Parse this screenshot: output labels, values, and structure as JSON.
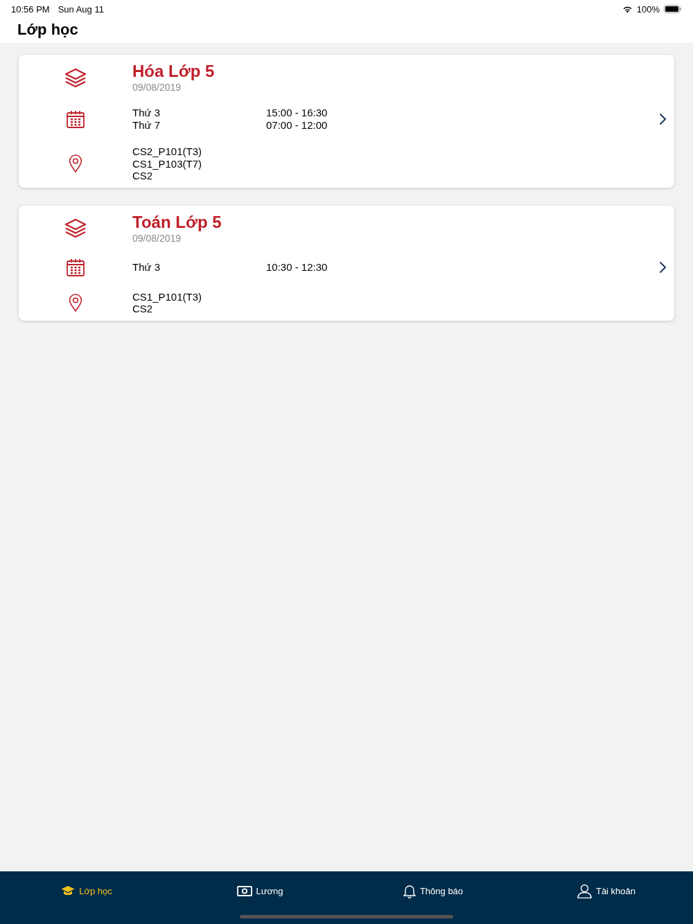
{
  "status_bar": {
    "time": "10:56 PM",
    "date": "Sun Aug 11",
    "battery": "100%"
  },
  "header": {
    "title": "Lớp học"
  },
  "classes": [
    {
      "name": "Hóa Lớp 5",
      "date": "09/08/2019",
      "schedule": [
        {
          "day": "Thứ 3",
          "time": "15:00 - 16:30"
        },
        {
          "day": "Thứ 7",
          "time": "07:00 - 12:00"
        }
      ],
      "locations": [
        "CS2_P101(T3)",
        "CS1_P103(T7)",
        "CS2"
      ]
    },
    {
      "name": "Toán Lớp 5",
      "date": "09/08/2019",
      "schedule": [
        {
          "day": "Thứ 3",
          "time": "10:30 - 12:30"
        }
      ],
      "locations": [
        "CS1_P101(T3)",
        "CS2"
      ]
    }
  ],
  "tabs": [
    {
      "label": "Lớp học",
      "kind": "class",
      "selected": true
    },
    {
      "label": "Lương",
      "kind": "salary",
      "selected": false
    },
    {
      "label": "Thông báo",
      "kind": "notification",
      "selected": false
    },
    {
      "label": "Tài khoản",
      "kind": "account",
      "selected": false
    }
  ]
}
